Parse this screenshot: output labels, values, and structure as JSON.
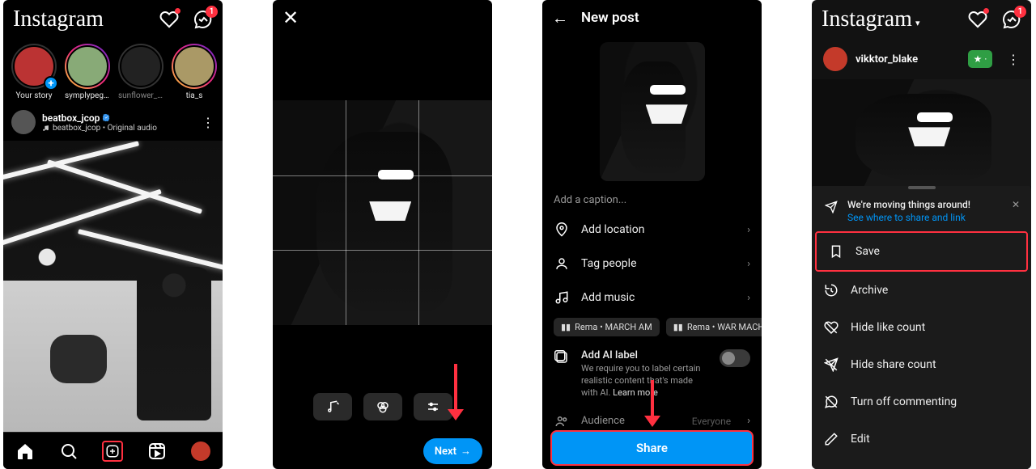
{
  "screen1": {
    "logo": "Instagram",
    "messenger_badge": "1",
    "stories": [
      {
        "label": "Your story",
        "own": true
      },
      {
        "label": "symplypeggie_",
        "ring": true
      },
      {
        "label": "sunflower_ya...",
        "faded": true
      },
      {
        "label": "tia_s",
        "ring": true
      }
    ],
    "post_user": "beatbox_jcop",
    "post_audio": "beatbox_jcop • Original audio"
  },
  "screen2": {
    "next": "Next"
  },
  "screen3": {
    "title": "New post",
    "caption_placeholder": "Add a caption...",
    "opts": {
      "location": "Add location",
      "tag": "Tag people",
      "music": "Add music"
    },
    "audio_suggestions": [
      "Rema • MARCH AM",
      "Rema • WAR MACHINE"
    ],
    "ai_label_title": "Add AI label",
    "ai_label_desc": "We require you to label certain realistic content that's made with AI.",
    "ai_learn_more": "Learn more",
    "audience_label": "Audience",
    "audience_value": "Everyone",
    "share": "Share"
  },
  "screen4": {
    "logo": "Instagram",
    "messenger_badge": "1",
    "username": "vikktor_blake",
    "star_badge": "★ ·",
    "notice_title": "We're moving things around!",
    "notice_link": "See where to share and link",
    "menu": {
      "save": "Save",
      "archive": "Archive",
      "hide_like": "Hide like count",
      "hide_share": "Hide share count",
      "turn_off_commenting": "Turn off commenting",
      "edit": "Edit"
    }
  }
}
